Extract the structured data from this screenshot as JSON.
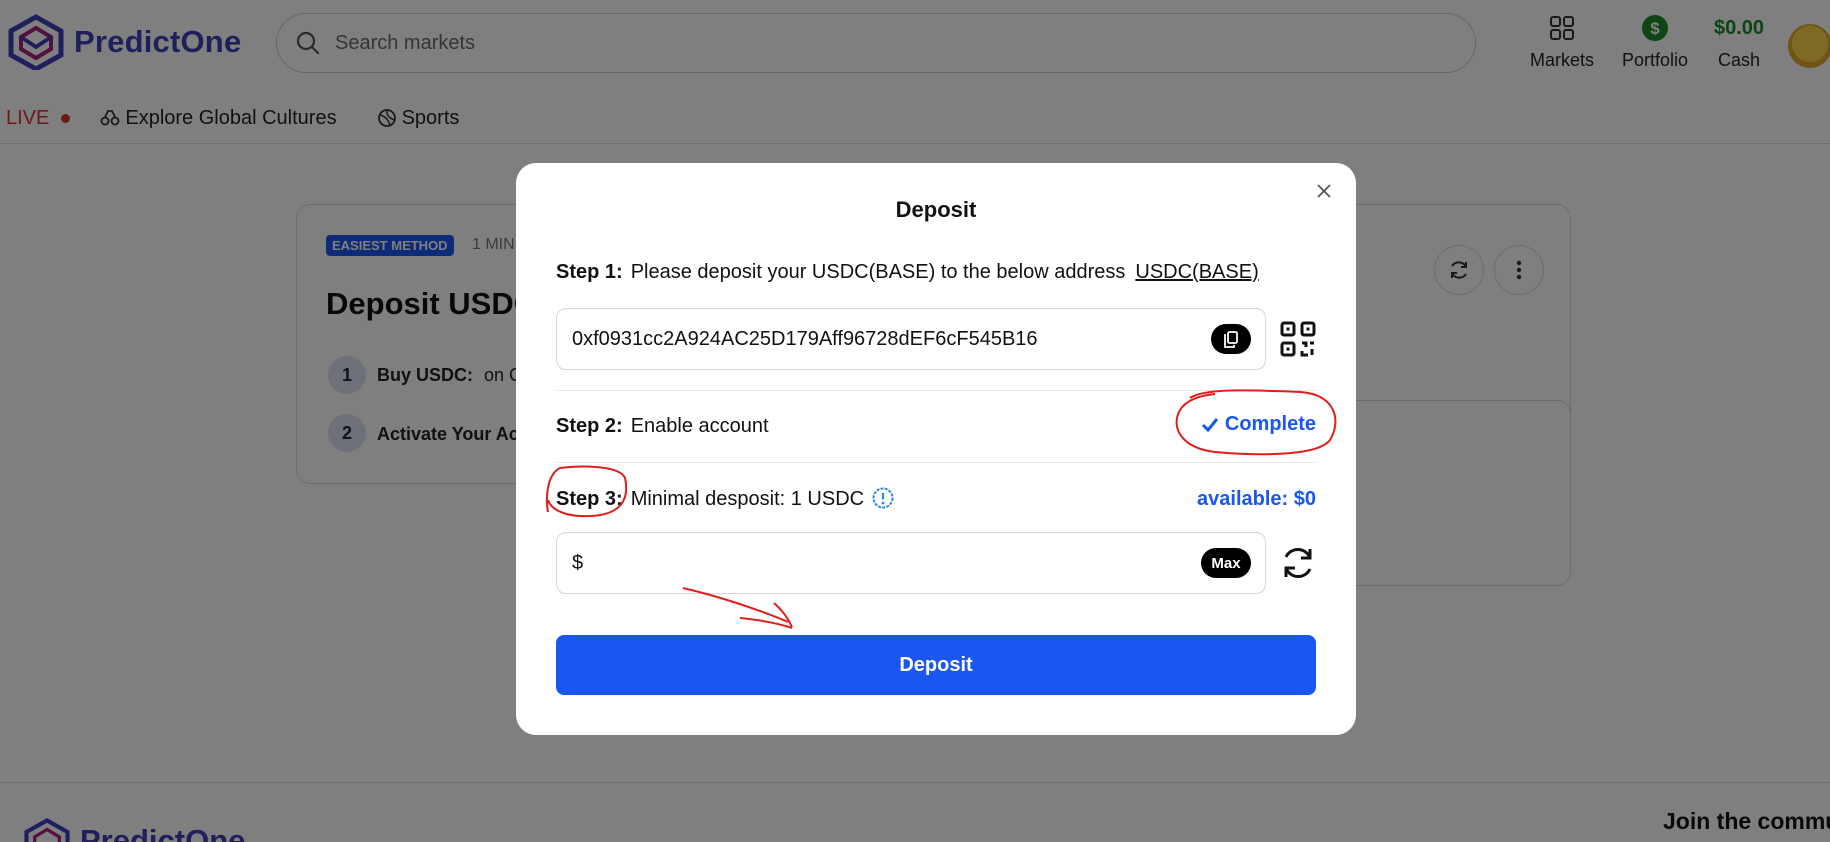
{
  "header": {
    "brand": "PredictOne",
    "search_placeholder": "Search markets",
    "nav": {
      "markets_label": "Markets",
      "portfolio_label": "Portfolio",
      "cash_value": "$0.00",
      "cash_label": "Cash"
    }
  },
  "subnav": {
    "live_label": "LIVE",
    "explore_label": "Explore Global Cultures",
    "sports_label": "Sports"
  },
  "background": {
    "badge": "EASIEST METHOD",
    "time_label": "1 MIN",
    "title": "Deposit USDC",
    "steps": [
      {
        "num": "1",
        "label": "Buy USDC:",
        "text": "on C"
      },
      {
        "num": "2",
        "label": "Activate Your Ac",
        "text": ""
      }
    ],
    "footer_brand": "PredictOne",
    "footer_join": "Join the commu"
  },
  "modal": {
    "title": "Deposit",
    "step1": {
      "label": "Step 1:",
      "text": "Please deposit your USDC(BASE) to the below address",
      "link": "USDC(BASE)",
      "address": "0xf0931cc2A924AC25D179Aff96728dEF6cF545B16"
    },
    "step2": {
      "label": "Step 2:",
      "text": "Enable account",
      "status": "Complete"
    },
    "step3": {
      "label": "Step 3:",
      "text": "Minimal desposit: 1 USDC",
      "available": "available: $0",
      "currency_prefix": "$",
      "amount_value": "",
      "max_label": "Max"
    },
    "deposit_button": "Deposit"
  },
  "colors": {
    "accent": "#1a56f0",
    "brand": "#3f3fb8",
    "cash": "#1a8a2a",
    "live": "#dd3333",
    "annotation": "#e01e1e"
  },
  "icons": [
    "logo-icon",
    "search-icon",
    "markets-grid-icon",
    "portfolio-dollar-icon",
    "avatar",
    "binoculars-icon",
    "sports-ball-icon",
    "refresh-icon",
    "more-vertical-icon",
    "close-icon",
    "copy-icon",
    "qr-code-icon",
    "check-icon",
    "info-icon",
    "reload-icon"
  ]
}
